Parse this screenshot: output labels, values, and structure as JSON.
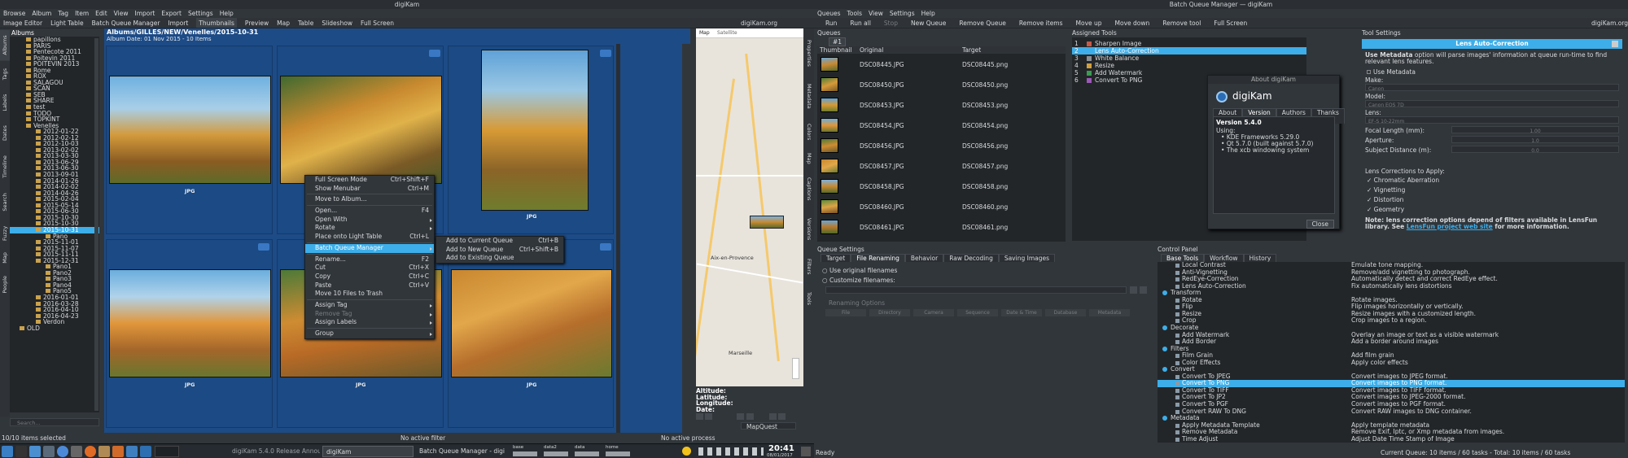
{
  "left_window": {
    "title": "digiKam",
    "menu": [
      "Browse",
      "Album",
      "Tag",
      "Item",
      "Edit",
      "View",
      "Import",
      "Export",
      "Settings",
      "Help"
    ],
    "toolbar": [
      "Image Editor",
      "Light Table",
      "Batch Queue Manager",
      "Import",
      "Thumbnails",
      "Preview",
      "Map",
      "Table",
      "Slideshow",
      "Full Screen"
    ],
    "website": "digiKam.org",
    "albums_header": "Albums",
    "album_path": "Albums/GILLES/NEW/Venelles/2015-10-31",
    "album_date": "Album Date: 01 Nov 2015 - 10 Items",
    "tree": [
      "papillons",
      "PARIS",
      "Pentecote 2011",
      "Poitevin 2011",
      "POITEVIN 2013",
      "Rome",
      "ROX",
      "SALAGOU",
      "SCAN",
      "SEB",
      "SHARE",
      "test",
      "TODO",
      "TOPKINT",
      "Venelles",
      "2012-01-22",
      "2012-02-12",
      "2012-10-03",
      "2013-02-02",
      "2013-03-30",
      "2013-06-29",
      "2013-06-30",
      "2013-09-01",
      "2014-01-26",
      "2014-02-02",
      "2014-04-26",
      "2015-02-04",
      "2015-05-14",
      "2015-06-30",
      "2015-10-30",
      "2015-10-30",
      "2015-10-31",
      "Pano",
      "2015-11-01",
      "2015-11-07",
      "2015-11-11",
      "2015-12-31",
      "Pano1",
      "Pano2",
      "Pano3",
      "Pano4",
      "Pano5",
      "2016-01-01",
      "2016-03-28",
      "2016-04-10",
      "2016-04-23",
      "Verdon",
      "OLD"
    ],
    "selected_album": "2015-10-31",
    "search_placeholder": "Search...",
    "left_tabs": [
      "Albums",
      "Tags",
      "Labels",
      "Dates",
      "Timeline",
      "Search",
      "Fuzzy",
      "Map",
      "People"
    ],
    "right_tabs": [
      "Properties",
      "Metadata",
      "Colors",
      "Map",
      "Captions",
      "Versions",
      "Filters",
      "Tools"
    ],
    "jpg_label": "JPG",
    "context_menu": [
      {
        "label": "Full Screen Mode",
        "shortcut": "Ctrl+Shift+F"
      },
      {
        "label": "Show Menubar",
        "shortcut": "Ctrl+M"
      },
      {
        "label": "Move to Album...",
        "shortcut": ""
      },
      {
        "label": "Open...",
        "shortcut": "F4"
      },
      {
        "label": "Open With",
        "shortcut": ""
      },
      {
        "label": "Rotate",
        "shortcut": ""
      },
      {
        "label": "Place onto Light Table",
        "shortcut": "Ctrl+L"
      },
      {
        "label": "Batch Queue Manager",
        "shortcut": ""
      },
      {
        "label": "Rename...",
        "shortcut": "F2"
      },
      {
        "label": "Cut",
        "shortcut": "Ctrl+X"
      },
      {
        "label": "Copy",
        "shortcut": "Ctrl+C"
      },
      {
        "label": "Paste",
        "shortcut": "Ctrl+V"
      },
      {
        "label": "Move 10 Files to Trash",
        "shortcut": ""
      },
      {
        "label": "Assign Tag",
        "shortcut": ""
      },
      {
        "label": "Remove Tag",
        "shortcut": ""
      },
      {
        "label": "Assign Labels",
        "shortcut": ""
      },
      {
        "label": "Group",
        "shortcut": ""
      }
    ],
    "submenu": [
      {
        "label": "Add to Current Queue",
        "shortcut": "Ctrl+B"
      },
      {
        "label": "Add to New Queue",
        "shortcut": "Ctrl+Shift+B"
      },
      {
        "label": "Add to Existing Queue",
        "shortcut": ""
      }
    ],
    "map": {
      "tab_map": "Map",
      "tab_satellite": "Satellite",
      "places": [
        "Aix-en-Provence",
        "Marseille"
      ],
      "altitude": "Altitude:",
      "latitude": "Latitude:",
      "longitude": "Longitude:",
      "date": "Date:",
      "provider": "MapQuest"
    },
    "status": {
      "selection": "10/10 items selected",
      "filter": "No active filter",
      "process": "No active process"
    }
  },
  "taskbar": {
    "items": [
      "digiKam 5.4.0 Release Annou",
      "digiKam",
      "Batch Queue Manager - digi"
    ],
    "meters": [
      "base",
      "data2",
      "data",
      "home"
    ],
    "time": "20:41",
    "date": "08/01/2017"
  },
  "right_window": {
    "title": "Batch Queue Manager — digiKam",
    "menu": [
      "Queues",
      "Tools",
      "View",
      "Settings",
      "Help"
    ],
    "toolbar": [
      "Run",
      "Run all",
      "Stop",
      "New Queue",
      "Remove Queue",
      "Remove items",
      "Move up",
      "Move down",
      "Remove tool",
      "Full Screen"
    ],
    "website": "digiKam.org",
    "queues_header": "Queues",
    "queue_tab": "#1",
    "columns": [
      "Thumbnail",
      "Original",
      "Target"
    ],
    "files": [
      {
        "original": "DSC08445.JPG",
        "target": "DSC08445.png"
      },
      {
        "original": "DSC08450.JPG",
        "target": "DSC08450.png"
      },
      {
        "original": "DSC08453.JPG",
        "target": "DSC08453.png"
      },
      {
        "original": "DSC08454.JPG",
        "target": "DSC08454.png"
      },
      {
        "original": "DSC08456.JPG",
        "target": "DSC08456.png"
      },
      {
        "original": "DSC08457.JPG",
        "target": "DSC08457.png"
      },
      {
        "original": "DSC08458.JPG",
        "target": "DSC08458.png"
      },
      {
        "original": "DSC08460.JPG",
        "target": "DSC08460.png"
      },
      {
        "original": "DSC08461.JPG",
        "target": "DSC08461.png"
      }
    ],
    "assigned_header": "Assigned Tools",
    "assigned": [
      "Sharpen Image",
      "Lens Auto-Correction",
      "White Balance",
      "Resize",
      "Add Watermark",
      "Convert To PNG"
    ],
    "about": {
      "title": "About digiKam",
      "app": "digiKam",
      "tabs": [
        "About",
        "Version",
        "Authors",
        "Thanks To"
      ],
      "version": "Version 5.4.0",
      "using": "Using:",
      "libs": [
        "KDE Frameworks 5.29.0",
        "Qt 5.7.0 (built against 5.7.0)",
        "The xcb windowing system"
      ],
      "close": "Close"
    },
    "tool_settings": {
      "header": "Tool Settings",
      "title": "Lens Auto-Correction",
      "desc_bold": "Use Metadata",
      "desc": " option will parse images' information at queue run-time to find relevant lens features.",
      "use_metadata": "Use Metadata",
      "make": "Make:",
      "make_val": "Canon",
      "model": "Model:",
      "model_val": "Canon EOS 7D",
      "lens": "Lens:",
      "lens_val": "EF-S 10-22mm",
      "focal": "Focal Length (mm):",
      "focal_val": "1.00",
      "aperture": "Aperture:",
      "aperture_val": "1.0",
      "distance": "Subject Distance (m):",
      "distance_val": "0.0",
      "corrections": "Lens Corrections to Apply:",
      "options": [
        "Chromatic Aberration",
        "Vignetting",
        "Distortion",
        "Geometry"
      ],
      "note_bold": "Note: lens correction options depend of filters available in LensFun library. See ",
      "note_link": "LensFun project web site",
      "note_end": " for more information."
    },
    "queue_settings": {
      "header": "Queue Settings",
      "tabs": [
        "Target",
        "File Renaming",
        "Behavior",
        "Raw Decoding",
        "Saving Images"
      ],
      "use_original": "Use original filenames",
      "customize": "Customize filenames:",
      "renaming_options": "Renaming Options",
      "buttons": [
        "File",
        "Directory",
        "Camera",
        "Sequence",
        "Date & Time",
        "Database",
        "Metadata"
      ]
    },
    "control_panel": {
      "header": "Control Panel",
      "tabs": [
        "Base Tools",
        "Workflow",
        "History"
      ],
      "rows": [
        {
          "t": "tool",
          "name": "Local Contrast",
          "desc": "Emulate tone mapping."
        },
        {
          "t": "tool",
          "name": "Anti-Vignetting",
          "desc": "Remove/add vignetting to photograph."
        },
        {
          "t": "tool",
          "name": "RedEye-Correction",
          "desc": "Automatically detect and correct RedEye effect."
        },
        {
          "t": "tool",
          "name": "Lens Auto-Correction",
          "desc": "Fix automatically lens distortions"
        },
        {
          "t": "group",
          "name": "Transform",
          "desc": ""
        },
        {
          "t": "tool",
          "name": "Rotate",
          "desc": "Rotate images."
        },
        {
          "t": "tool",
          "name": "Flip",
          "desc": "Flip images horizontally or vertically."
        },
        {
          "t": "tool",
          "name": "Resize",
          "desc": "Resize images with a customized length."
        },
        {
          "t": "tool",
          "name": "Crop",
          "desc": "Crop images to a region."
        },
        {
          "t": "group",
          "name": "Decorate",
          "desc": ""
        },
        {
          "t": "tool",
          "name": "Add Watermark",
          "desc": "Overlay an image or text as a visible watermark"
        },
        {
          "t": "tool",
          "name": "Add Border",
          "desc": "Add a border around images"
        },
        {
          "t": "group",
          "name": "Filters",
          "desc": ""
        },
        {
          "t": "tool",
          "name": "Film Grain",
          "desc": "Add film grain"
        },
        {
          "t": "tool",
          "name": "Color Effects",
          "desc": "Apply color effects"
        },
        {
          "t": "group",
          "name": "Convert",
          "desc": ""
        },
        {
          "t": "tool",
          "name": "Convert To JPEG",
          "desc": "Convert images to JPEG format."
        },
        {
          "t": "sel",
          "name": "Convert To PNG",
          "desc": "Convert images to PNG format."
        },
        {
          "t": "tool",
          "name": "Convert To TIFF",
          "desc": "Convert images to TIFF format."
        },
        {
          "t": "tool",
          "name": "Convert To JP2",
          "desc": "Convert images to JPEG-2000 format."
        },
        {
          "t": "tool",
          "name": "Convert To PGF",
          "desc": "Convert images to PGF format."
        },
        {
          "t": "tool",
          "name": "Convert RAW To DNG",
          "desc": "Convert RAW images to DNG container."
        },
        {
          "t": "group",
          "name": "Metadata",
          "desc": ""
        },
        {
          "t": "tool",
          "name": "Apply Metadata Template",
          "desc": "Apply template metadata"
        },
        {
          "t": "tool",
          "name": "Remove Metadata",
          "desc": "Remove Exif, Iptc, or Xmp metadata from images."
        },
        {
          "t": "tool",
          "name": "Time Adjust",
          "desc": "Adjust Date Time Stamp of Image"
        }
      ]
    },
    "status": {
      "left": "Ready",
      "right": "Current Queue: 10 items / 60 tasks - Total: 10 items / 60 tasks"
    }
  },
  "colors": {
    "accent": "#3daee9",
    "window": "#31363b",
    "view": "#232629",
    "album_bg": "#1d4b86"
  }
}
